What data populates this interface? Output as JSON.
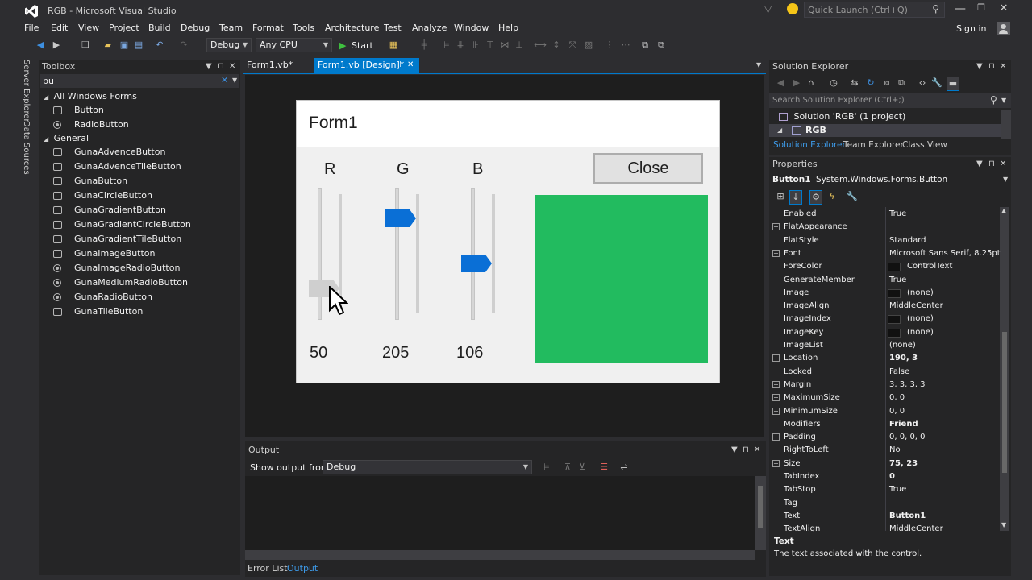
{
  "window": {
    "title": "RGB - Microsoft Visual Studio",
    "quick_launch_placeholder": "Quick Launch (Ctrl+Q)",
    "sign_in": "Sign in"
  },
  "menu": [
    "File",
    "Edit",
    "View",
    "Project",
    "Build",
    "Debug",
    "Team",
    "Format",
    "Tools",
    "Architecture",
    "Test",
    "Analyze",
    "Window",
    "Help"
  ],
  "toolbar": {
    "config": "Debug",
    "platform": "Any CPU",
    "start_label": "Start"
  },
  "side_tabs": [
    "Server Explorer",
    "Data Sources"
  ],
  "toolbox": {
    "title": "Toolbox",
    "search_value": "bu",
    "groups": [
      {
        "name": "All Windows Forms",
        "items": [
          {
            "label": "Button",
            "icon": "button-icon"
          },
          {
            "label": "RadioButton",
            "icon": "radio-icon"
          }
        ]
      },
      {
        "name": "General",
        "items": [
          {
            "label": "GunaAdvenceButton",
            "icon": "button-icon"
          },
          {
            "label": "GunaAdvenceTileButton",
            "icon": "button-icon"
          },
          {
            "label": "GunaButton",
            "icon": "button-icon"
          },
          {
            "label": "GunaCircleButton",
            "icon": "button-icon"
          },
          {
            "label": "GunaGradientButton",
            "icon": "button-icon"
          },
          {
            "label": "GunaGradientCircleButton",
            "icon": "button-icon"
          },
          {
            "label": "GunaGradientTileButton",
            "icon": "button-icon"
          },
          {
            "label": "GunaImageButton",
            "icon": "button-icon"
          },
          {
            "label": "GunaImageRadioButton",
            "icon": "radio-icon"
          },
          {
            "label": "GunaMediumRadioButton",
            "icon": "radio-icon"
          },
          {
            "label": "GunaRadioButton",
            "icon": "radio-icon"
          },
          {
            "label": "GunaTileButton",
            "icon": "button-icon"
          }
        ]
      }
    ]
  },
  "tabs": [
    {
      "label": "Form1.vb*",
      "active": false
    },
    {
      "label": "Form1.vb [Design]*",
      "active": true
    }
  ],
  "designer": {
    "form_title": "Form1",
    "labels": [
      "R",
      "G",
      "B"
    ],
    "close_button": "Close",
    "values": {
      "r": "50",
      "g": "205",
      "b": "106"
    },
    "slider_levels": {
      "r": 0.196,
      "g": 0.804,
      "b": 0.416
    },
    "preview_color": "#22bb5f",
    "thumb_color": "#0a6fd6"
  },
  "output": {
    "title": "Output",
    "show_from_label": "Show output from:",
    "source": "Debug",
    "bottom_tabs": [
      "Error List",
      "Output"
    ]
  },
  "solution_explorer": {
    "title": "Solution Explorer",
    "search_placeholder": "Search Solution Explorer (Ctrl+;)",
    "solution": "Solution 'RGB' (1 project)",
    "project": "RGB",
    "tabs": [
      "Solution Explorer",
      "Team Explorer",
      "Class View"
    ]
  },
  "properties": {
    "title": "Properties",
    "object": "Button1",
    "object_type": "System.Windows.Forms.Button",
    "rows": [
      {
        "name": "Enabled",
        "value": "True",
        "expandable": false,
        "bold": false,
        "swatch": false
      },
      {
        "name": "FlatAppearance",
        "value": "",
        "expandable": true,
        "bold": false,
        "swatch": false
      },
      {
        "name": "FlatStyle",
        "value": "Standard",
        "expandable": false,
        "bold": false,
        "swatch": false
      },
      {
        "name": "Font",
        "value": "Microsoft Sans Serif, 8.25pt",
        "expandable": true,
        "bold": false,
        "swatch": false
      },
      {
        "name": "ForeColor",
        "value": "ControlText",
        "expandable": false,
        "bold": false,
        "swatch": true
      },
      {
        "name": "GenerateMember",
        "value": "True",
        "expandable": false,
        "bold": false,
        "swatch": false
      },
      {
        "name": "Image",
        "value": "(none)",
        "expandable": false,
        "bold": false,
        "swatch": true
      },
      {
        "name": "ImageAlign",
        "value": "MiddleCenter",
        "expandable": false,
        "bold": false,
        "swatch": false
      },
      {
        "name": "ImageIndex",
        "value": "(none)",
        "expandable": false,
        "bold": false,
        "swatch": true
      },
      {
        "name": "ImageKey",
        "value": "(none)",
        "expandable": false,
        "bold": false,
        "swatch": true
      },
      {
        "name": "ImageList",
        "value": "(none)",
        "expandable": false,
        "bold": false,
        "swatch": false
      },
      {
        "name": "Location",
        "value": "190, 3",
        "expandable": true,
        "bold": true,
        "swatch": false
      },
      {
        "name": "Locked",
        "value": "False",
        "expandable": false,
        "bold": false,
        "swatch": false
      },
      {
        "name": "Margin",
        "value": "3, 3, 3, 3",
        "expandable": true,
        "bold": false,
        "swatch": false
      },
      {
        "name": "MaximumSize",
        "value": "0, 0",
        "expandable": true,
        "bold": false,
        "swatch": false
      },
      {
        "name": "MinimumSize",
        "value": "0, 0",
        "expandable": true,
        "bold": false,
        "swatch": false
      },
      {
        "name": "Modifiers",
        "value": "Friend",
        "expandable": false,
        "bold": true,
        "swatch": false
      },
      {
        "name": "Padding",
        "value": "0, 0, 0, 0",
        "expandable": true,
        "bold": false,
        "swatch": false
      },
      {
        "name": "RightToLeft",
        "value": "No",
        "expandable": false,
        "bold": false,
        "swatch": false
      },
      {
        "name": "Size",
        "value": "75, 23",
        "expandable": true,
        "bold": true,
        "swatch": false
      },
      {
        "name": "TabIndex",
        "value": "0",
        "expandable": false,
        "bold": true,
        "swatch": false
      },
      {
        "name": "TabStop",
        "value": "True",
        "expandable": false,
        "bold": false,
        "swatch": false
      },
      {
        "name": "Tag",
        "value": "",
        "expandable": false,
        "bold": false,
        "swatch": false
      },
      {
        "name": "Text",
        "value": "Button1",
        "expandable": false,
        "bold": true,
        "swatch": false
      },
      {
        "name": "TextAlign",
        "value": "MiddleCenter",
        "expandable": false,
        "bold": false,
        "swatch": false
      }
    ],
    "desc_title": "Text",
    "desc_body": "The text associated with the control."
  },
  "colors": {
    "accent": "#007acc",
    "bg": "#2d2d30",
    "panel": "#252526",
    "designer_bg": "#1e1e1e"
  }
}
